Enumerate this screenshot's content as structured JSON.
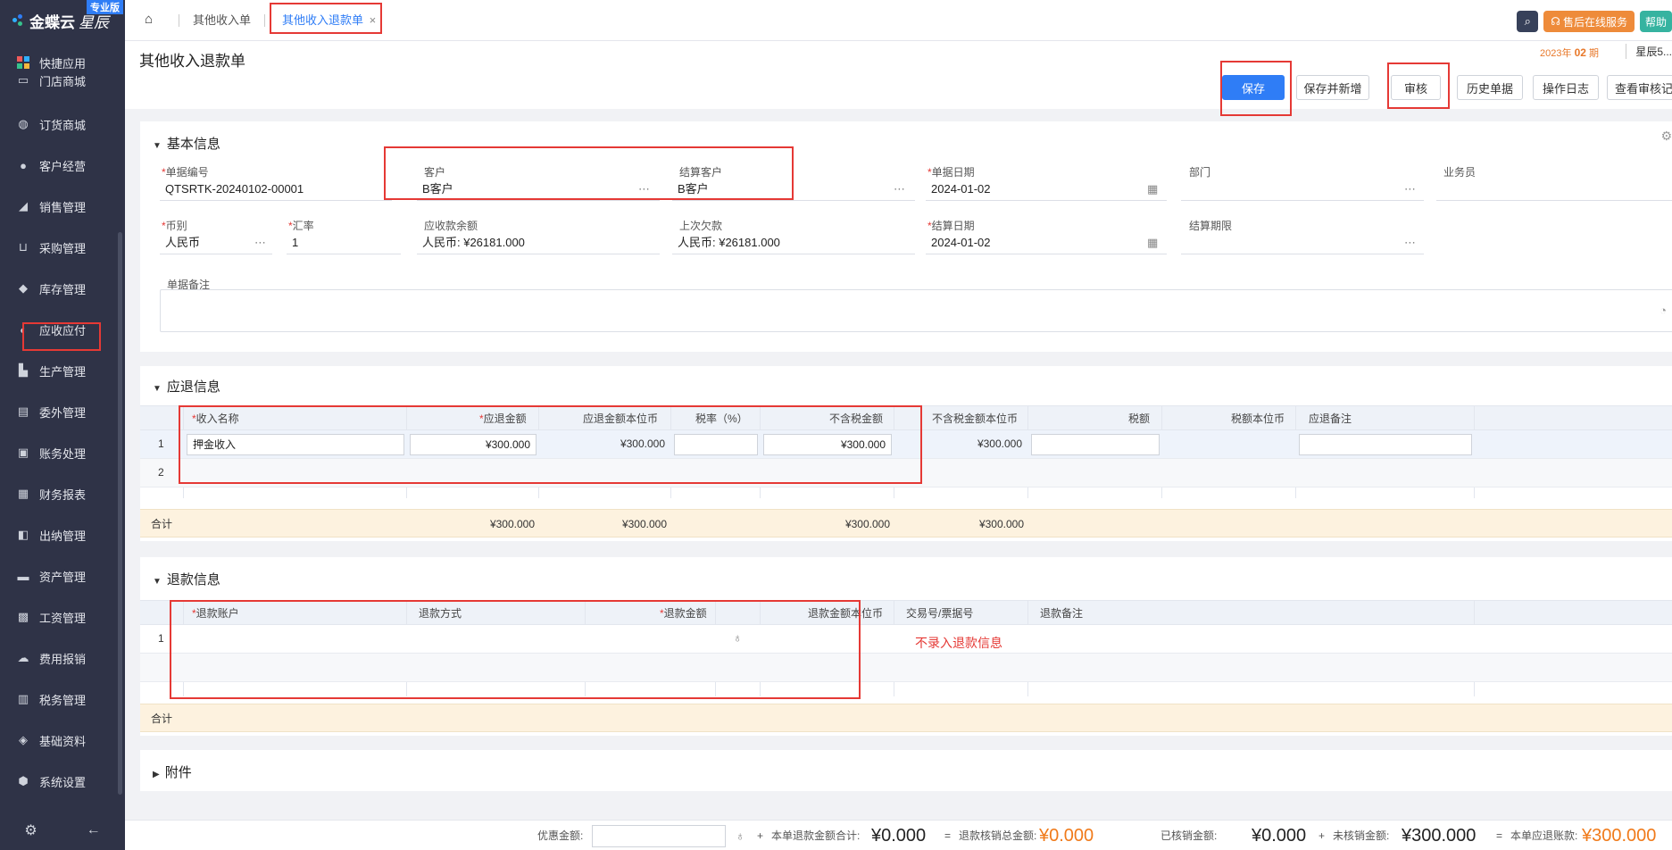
{
  "app": {
    "brand": "金蝶云",
    "brand_sub": "星辰",
    "edition": "专业版"
  },
  "sidebar": {
    "items": [
      {
        "label": "快捷应用",
        "icon": "apps-grid-icon"
      },
      {
        "label": "门店商城",
        "icon": "store-icon"
      },
      {
        "label": "订货商城",
        "icon": "shopping-bag-icon"
      },
      {
        "label": "客户经营",
        "icon": "customer-icon"
      },
      {
        "label": "销售管理",
        "icon": "sales-chart-icon"
      },
      {
        "label": "采购管理",
        "icon": "cart-icon"
      },
      {
        "label": "库存管理",
        "icon": "box-icon"
      },
      {
        "label": "应收应付",
        "icon": "receivable-icon"
      },
      {
        "label": "生产管理",
        "icon": "factory-icon"
      },
      {
        "label": "委外管理",
        "icon": "outsource-icon"
      },
      {
        "label": "账务处理",
        "icon": "ledger-icon"
      },
      {
        "label": "财务报表",
        "icon": "report-icon"
      },
      {
        "label": "出纳管理",
        "icon": "cashier-icon"
      },
      {
        "label": "资产管理",
        "icon": "asset-icon"
      },
      {
        "label": "工资管理",
        "icon": "salary-icon"
      },
      {
        "label": "费用报销",
        "icon": "expense-icon"
      },
      {
        "label": "税务管理",
        "icon": "tax-icon"
      },
      {
        "label": "基础资料",
        "icon": "layers-icon"
      },
      {
        "label": "系统设置",
        "icon": "settings-icon"
      }
    ]
  },
  "topbar": {
    "tabs": [
      {
        "label": "其他收入单"
      },
      {
        "label": "其他收入退款单",
        "close": "×"
      }
    ],
    "service_label": "售后在线服务",
    "help_label": "帮助"
  },
  "header": {
    "title": "其他收入退款单",
    "period_year": "2023年",
    "period_num": "02",
    "period_unit": "期",
    "user": "星辰5..."
  },
  "toolbar": {
    "save": "保存",
    "save_new": "保存并新增",
    "audit": "审核",
    "history": "历史单据",
    "log": "操作日志",
    "view_audit": "查看审核记"
  },
  "basic": {
    "title": "基本信息",
    "bill_no_label": "单据编号",
    "bill_no": "QTSRTK-20240102-00001",
    "customer_label": "客户",
    "customer": "B客户",
    "settle_customer_label": "结算客户",
    "settle_customer": "B客户",
    "bill_date_label": "单据日期",
    "bill_date": "2024-01-02",
    "dept_label": "部门",
    "dept": "",
    "salesman_label": "业务员",
    "salesman": "",
    "currency_label": "币别",
    "currency": "人民币",
    "rate_label": "汇率",
    "rate": "1",
    "receivable_label": "应收款余额",
    "receivable": "人民币: ¥26181.000",
    "last_debt_label": "上次欠款",
    "last_debt": "人民币: ¥26181.000",
    "settle_date_label": "结算日期",
    "settle_date": "2024-01-02",
    "settle_term_label": "结算期限",
    "settle_term": "",
    "remark_label": "单据备注"
  },
  "refund_due": {
    "title": "应退信息",
    "headers": [
      "收入名称",
      "应退金额",
      "应退金额本位币",
      "税率（%）",
      "不含税金额",
      "不含税金额本位币",
      "税额",
      "税额本位币",
      "应退备注"
    ],
    "rows": [
      {
        "no": "1",
        "name": "押金收入",
        "amount": "¥300.000",
        "amount_base": "¥300.000",
        "tax_rate": "",
        "net": "¥300.000",
        "net_base": "¥300.000",
        "tax": "",
        "tax_base": "",
        "remark": ""
      },
      {
        "no": "2"
      }
    ],
    "total_label": "合计",
    "total_amount": "¥300.000",
    "total_amount_base": "¥300.000",
    "total_net": "¥300.000",
    "total_net_base": "¥300.000"
  },
  "refund": {
    "title": "退款信息",
    "headers": [
      "退款账户",
      "退款方式",
      "退款金额",
      "退款金额本位币",
      "交易号/票据号",
      "退款备注"
    ],
    "rows": [
      {
        "no": "1"
      }
    ],
    "annotation": "不录入退款信息",
    "total_label": "合计"
  },
  "attachment": {
    "title": "附件"
  },
  "footer": {
    "discount_label": "优惠金额:",
    "plus1": "+",
    "refund_total_label": "本单退款金额合计:",
    "refund_total": "¥0.000",
    "eq1": "=",
    "refund_writeoff_label": "退款核销总金额:",
    "refund_writeoff": "¥0.000",
    "written_label": "已核销金额:",
    "written": "¥0.000",
    "plus2": "+",
    "unwritten_label": "未核销金额:",
    "unwritten": "¥300.000",
    "eq2": "=",
    "due_label": "本单应退账款:",
    "due": "¥300.000"
  },
  "colors": {
    "primary": "#2f7df6",
    "sidebar": "#2f3347",
    "annotation": "#e53935",
    "accent_orange": "#f07a1a"
  }
}
